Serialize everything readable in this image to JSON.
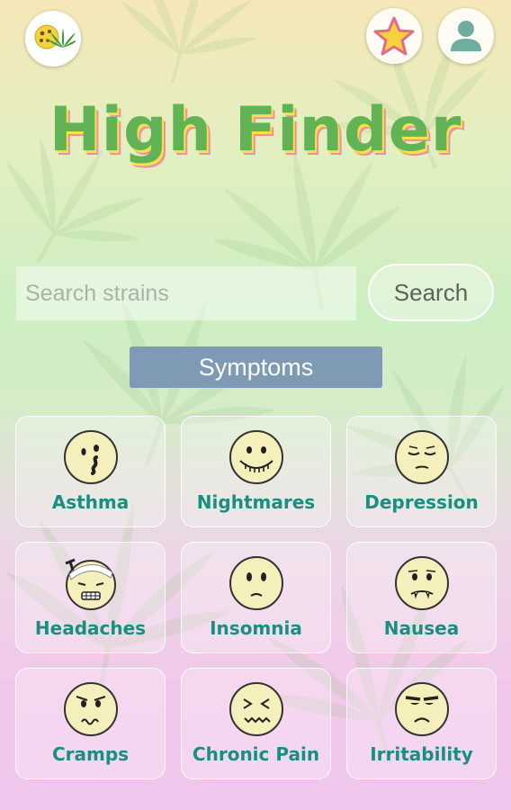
{
  "app": {
    "title": "High Finder"
  },
  "header": {
    "logo_icon": "cookie-leaf-logo-icon",
    "favorites_icon": "star-icon",
    "profile_icon": "user-icon"
  },
  "search": {
    "placeholder": "Search strains",
    "value": "",
    "button_label": "Search"
  },
  "section": {
    "title": "Symptoms"
  },
  "symptoms": [
    {
      "label": "Asthma",
      "icon": "asthma-face-icon"
    },
    {
      "label": "Nightmares",
      "icon": "nightmares-face-icon"
    },
    {
      "label": "Depression",
      "icon": "depression-face-icon"
    },
    {
      "label": "Headaches",
      "icon": "headaches-face-icon"
    },
    {
      "label": "Insomnia",
      "icon": "insomnia-face-icon"
    },
    {
      "label": "Nausea",
      "icon": "nausea-face-icon"
    },
    {
      "label": "Cramps",
      "icon": "cramps-face-icon"
    },
    {
      "label": "Chronic Pain",
      "icon": "chronic-pain-face-icon"
    },
    {
      "label": "Irritability",
      "icon": "irritability-face-icon"
    }
  ],
  "colors": {
    "title": "#62b256",
    "title_shadow_yellow": "#f4e24a",
    "title_shadow_pink": "#ef8f9f",
    "label": "#1b8e80",
    "symptoms_header": "#7e9ab4",
    "face_fill": "#f5efbc",
    "star": "#f6d33c"
  }
}
